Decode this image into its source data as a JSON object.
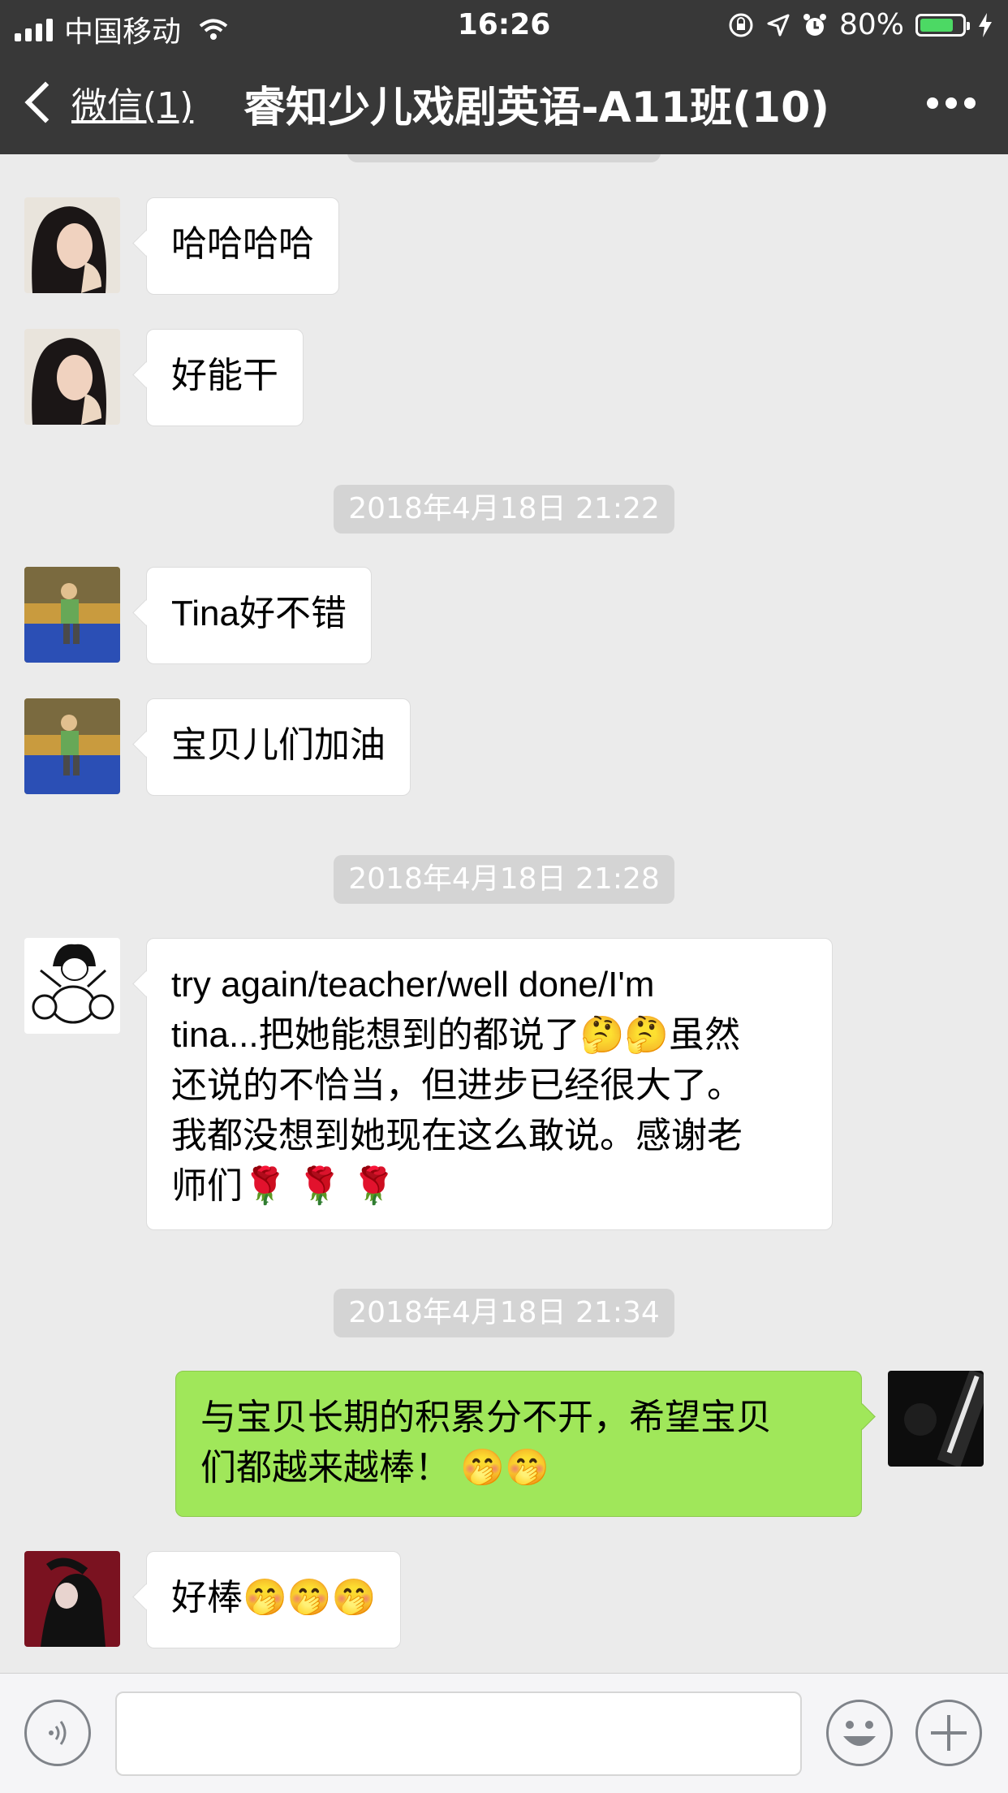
{
  "status_bar": {
    "carrier": "中国移动",
    "time": "16:26",
    "battery": "80%",
    "battery_level": 0.8
  },
  "nav": {
    "back_label": "微信(1)",
    "title": "睿知少儿戏剧英语-A11班(10)"
  },
  "messages": [
    {
      "type": "in",
      "avatar": "avatar-woman-curly-hair",
      "text": "哈哈哈哈"
    },
    {
      "type": "in",
      "avatar": "avatar-woman-curly-hair",
      "text": "好能干"
    },
    {
      "type": "time",
      "text": "2018年4月18日 21:22"
    },
    {
      "type": "in",
      "avatar": "avatar-child-poolside",
      "text": "Tina好不错"
    },
    {
      "type": "in",
      "avatar": "avatar-child-poolside",
      "text": "宝贝儿们加油"
    },
    {
      "type": "time",
      "text": "2018年4月18日 21:28"
    },
    {
      "type": "in",
      "avatar": "avatar-drummer-cartoon",
      "lines": [
        "try again/teacher/well done/I'm",
        "tina...把她能想到的都说了🤔🤔虽然",
        "还说的不恰当，但进步已经很大了。",
        "我都没想到她现在这么敢说。感谢老",
        "师们🌹 🌹 🌹"
      ]
    },
    {
      "type": "time",
      "text": "2018年4月18日 21:34"
    },
    {
      "type": "out",
      "avatar": "avatar-dark-photo",
      "lines": [
        "与宝贝长期的积累分不开，希望宝贝",
        "们都越来越棒！ 🤭🤭"
      ]
    },
    {
      "type": "in",
      "avatar": "avatar-red-figure",
      "text": "好棒🤭🤭🤭"
    }
  ],
  "input_bar": {
    "voice_icon": "voice-icon",
    "emoji_icon": "smiley-icon",
    "plus_icon": "plus-icon",
    "text_value": ""
  }
}
